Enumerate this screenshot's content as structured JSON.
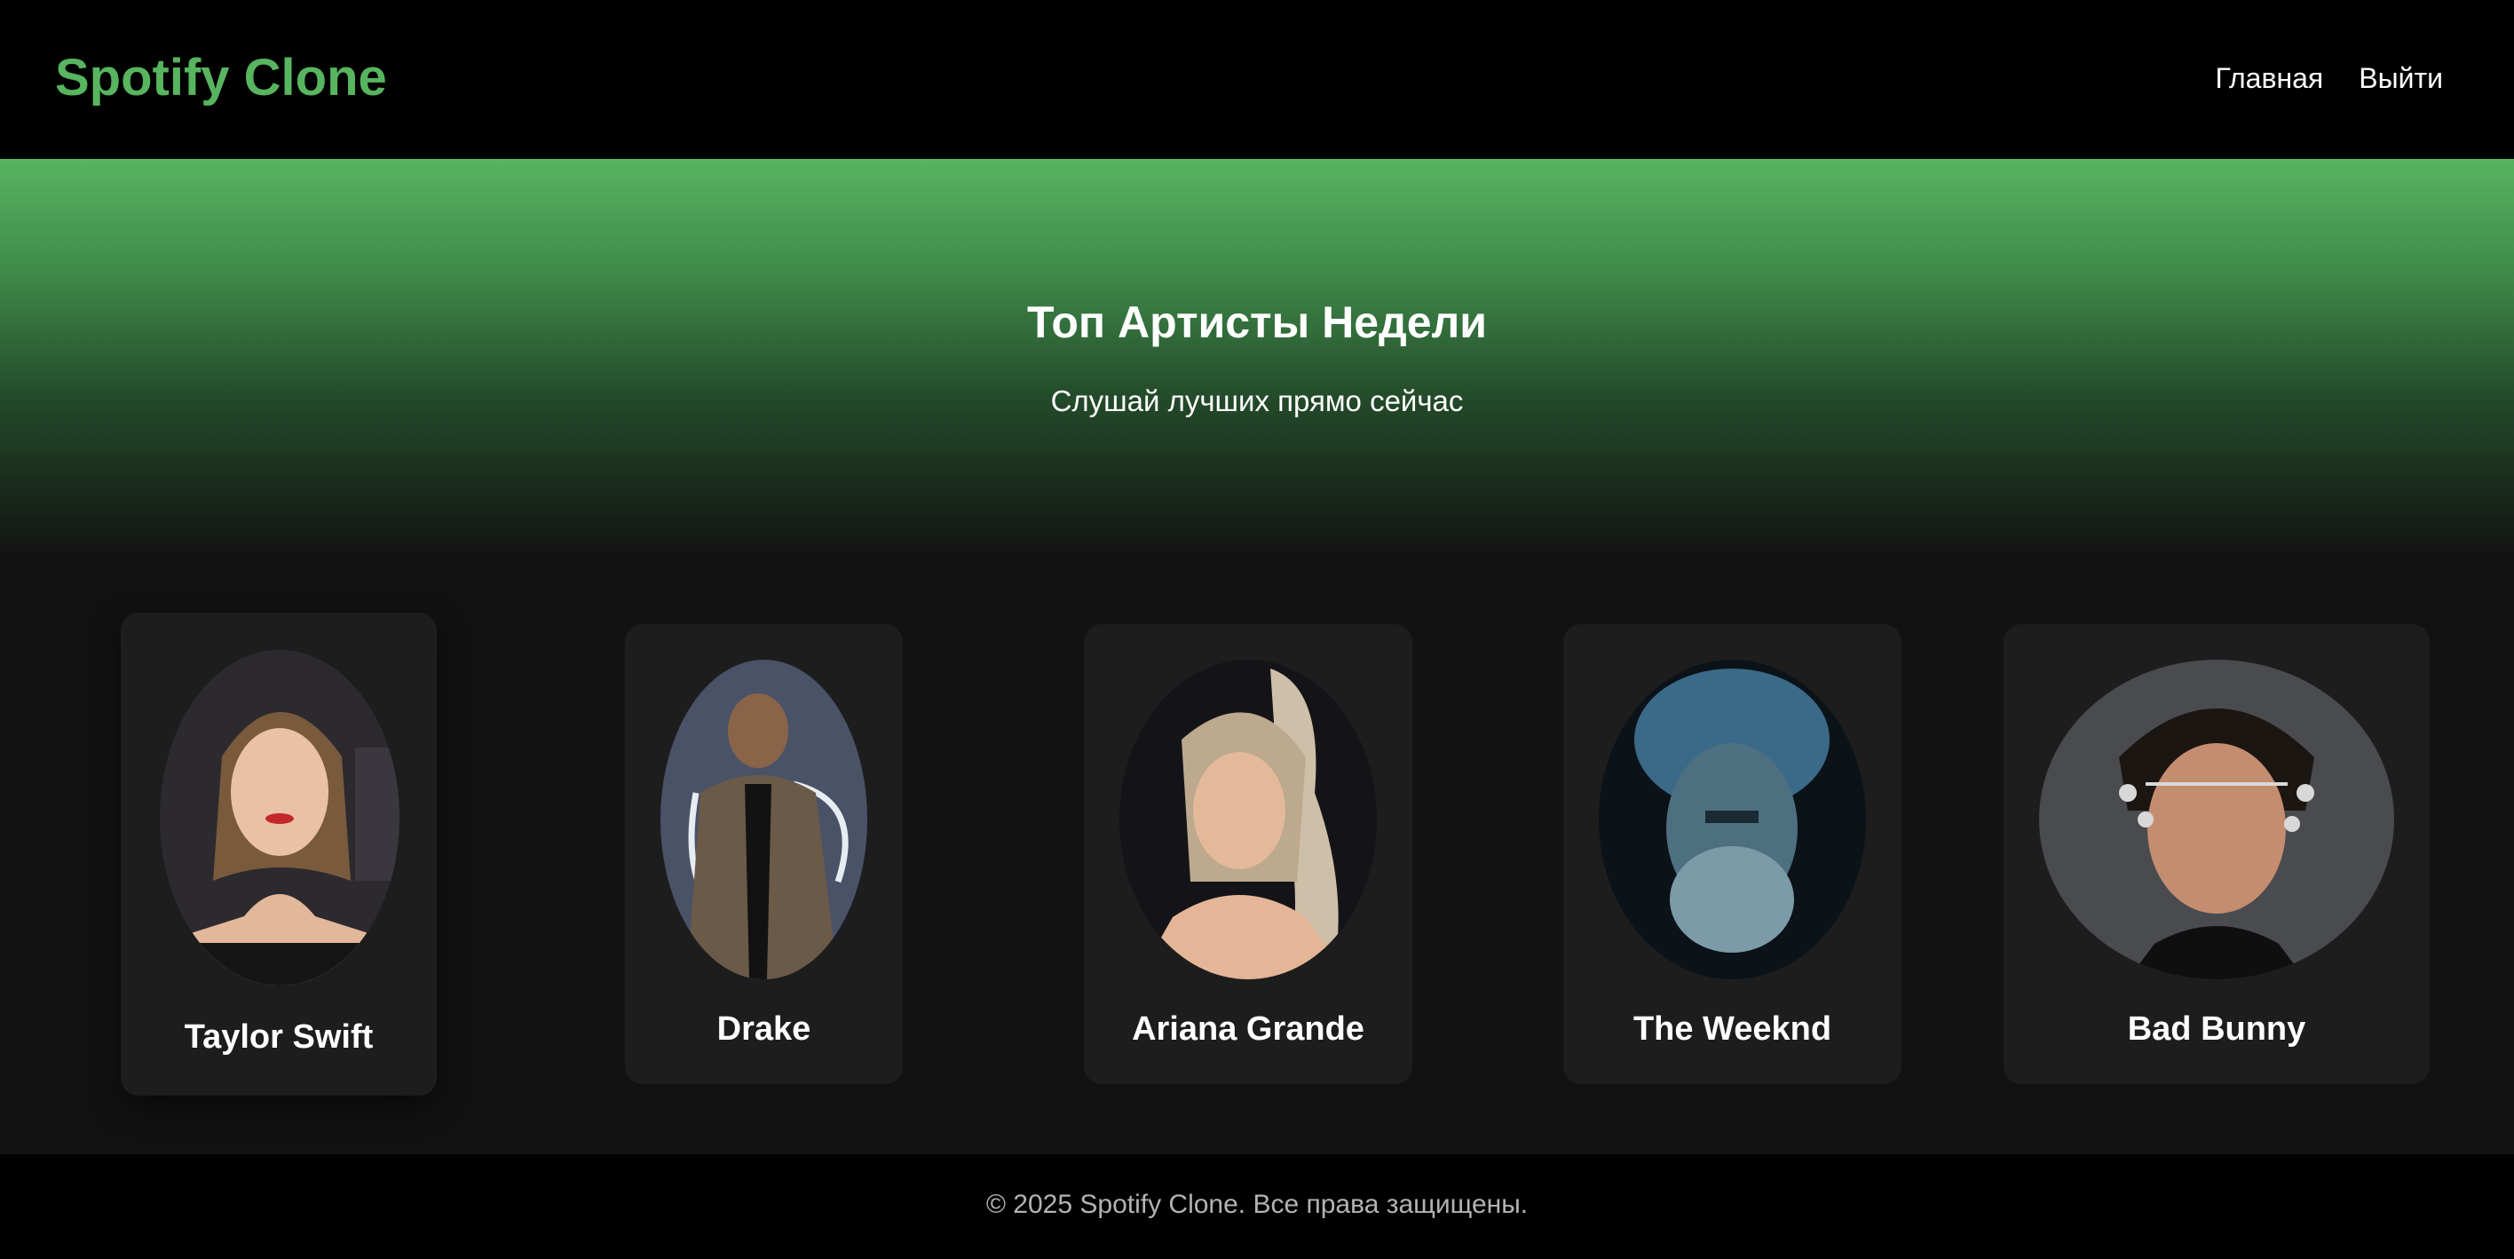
{
  "header": {
    "logo": "Spotify Clone",
    "nav": [
      {
        "label": "Главная"
      },
      {
        "label": "Выйти"
      }
    ]
  },
  "hero": {
    "title": "Топ Артисты Недели",
    "subtitle": "Слушай лучших прямо сейчас"
  },
  "artists": [
    {
      "name": "Taylor Swift"
    },
    {
      "name": "Drake"
    },
    {
      "name": "Ariana Grande"
    },
    {
      "name": "The Weeknd"
    },
    {
      "name": "Bad Bunny"
    }
  ],
  "footer": {
    "copyright": "© 2025 Spotify Clone. Все права защищены."
  },
  "colors": {
    "accent": "#57b45f",
    "background": "#121212",
    "card": "#1d1d1d",
    "header": "#000000"
  }
}
